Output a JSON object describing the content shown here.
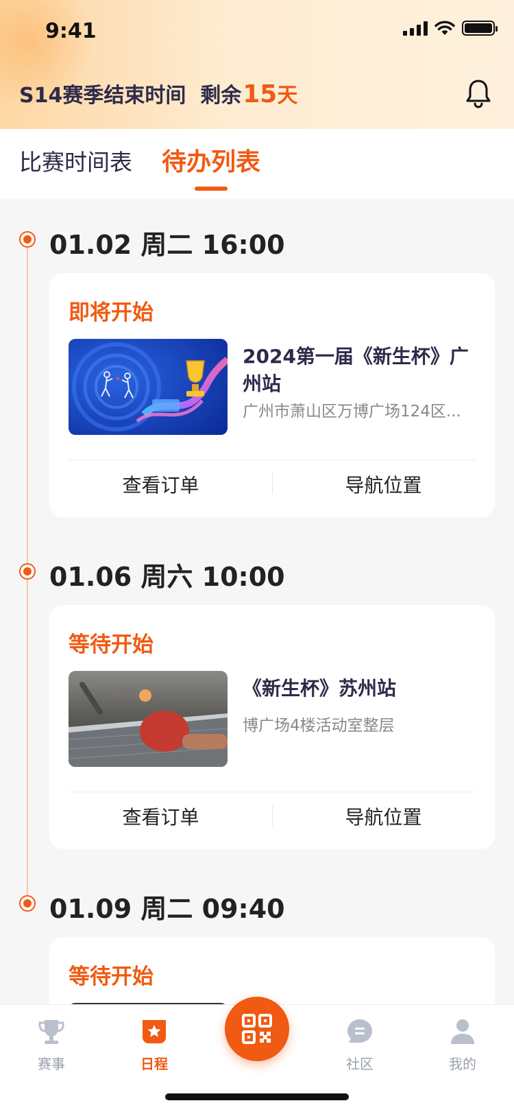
{
  "status_bar": {
    "time": "9:41"
  },
  "header": {
    "season_prefix": "S14赛季结束时间  剩余",
    "season_days": "15",
    "season_unit": "天"
  },
  "tabs": [
    {
      "label": "比赛时间表",
      "active": false
    },
    {
      "label": "待办列表",
      "active": true
    }
  ],
  "events": [
    {
      "date": "01.02 周二 16:00",
      "status": "即将开始",
      "title": "2024第一届《新生杯》广州站",
      "address": "广州市萧山区万博广场124区...",
      "actions": [
        "查看订单",
        "导航位置"
      ]
    },
    {
      "date": "01.06 周六 10:00",
      "status": "等待开始",
      "title": "《新生杯》苏州站",
      "address": "博广场4楼活动室整层",
      "actions": [
        "查看订单",
        "导航位置"
      ]
    },
    {
      "date": "01.09 周二 09:40",
      "status": "等待开始"
    }
  ],
  "bottom_nav": [
    {
      "label": "赛事",
      "icon": "trophy-icon",
      "active": false
    },
    {
      "label": "日程",
      "icon": "schedule-star-icon",
      "active": true
    },
    {
      "label": "",
      "icon": "qr-code-icon",
      "active": false
    },
    {
      "label": "社区",
      "icon": "chat-bubble-icon",
      "active": false
    },
    {
      "label": "我的",
      "icon": "user-icon",
      "active": false
    }
  ],
  "colors": {
    "accent": "#f05a12",
    "title": "#2d2a4a",
    "muted": "#888888",
    "nav_inactive": "#9aa0b0"
  }
}
